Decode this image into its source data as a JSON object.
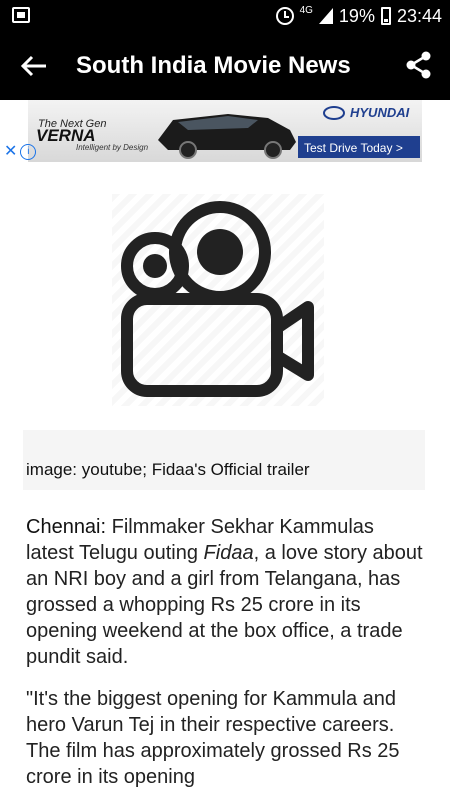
{
  "status_bar": {
    "network": "4G",
    "battery": "19%",
    "time": "23:44"
  },
  "app_bar": {
    "title": "South India Movie News"
  },
  "ad": {
    "tagline_top": "The Next Gen",
    "model": "VERNA",
    "tagline_bottom": "Intelligent by Design",
    "brand": "HYUNDAI",
    "cta": "Test Drive Today >"
  },
  "article": {
    "image_caption": "image: youtube; Fidaa's Official trailer",
    "lead_label": "Chennai:",
    "p1_before": " Filmmaker Sekhar Kammulas latest Telugu outing ",
    "p1_italic": "Fidaa",
    "p1_after": ", a love story about an NRI boy and a girl from Telangana, has grossed a whopping Rs 25 crore in its opening weekend at the box office, a trade pundit said.",
    "p2": "\"It's the biggest opening for Kammula and hero Varun Tej in their respective careers. The film has approximately grossed Rs 25 crore in its opening"
  },
  "colors": {
    "bar_bg": "#000000",
    "ad_cta": "#1f3f8f",
    "ad_info": "#1a73e8"
  }
}
